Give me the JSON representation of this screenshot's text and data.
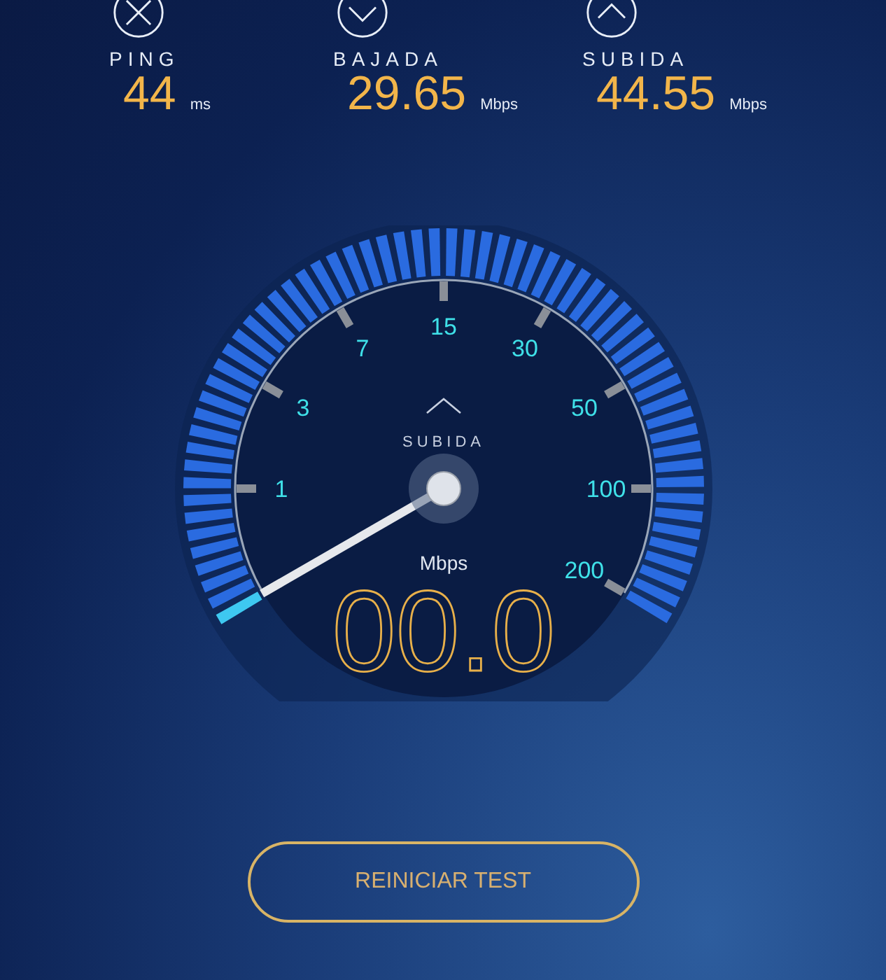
{
  "stats": [
    {
      "kind": "ping",
      "label": "PING",
      "value": "44",
      "unit": "ms"
    },
    {
      "kind": "download",
      "label": "BAJADA",
      "value": "29.65",
      "unit": "Mbps"
    },
    {
      "kind": "upload",
      "label": "SUBIDA",
      "value": "44.55",
      "unit": "Mbps"
    }
  ],
  "gauge": {
    "mode": "SUBIDA",
    "scale": [
      "1",
      "3",
      "7",
      "15",
      "30",
      "50",
      "100",
      "200"
    ],
    "unit": "Mbps",
    "reading": "00.0"
  },
  "button": "REINICIAR TEST"
}
